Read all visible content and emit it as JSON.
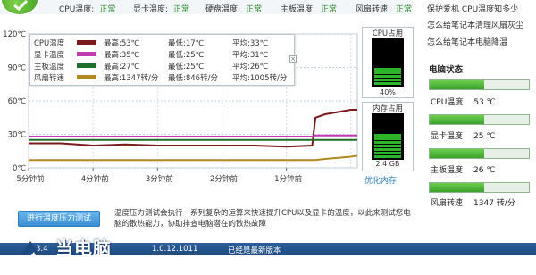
{
  "topbar": {
    "stats": [
      {
        "label": "CPU温度:",
        "status": "正常"
      },
      {
        "label": "显卡温度:",
        "status": "正常"
      },
      {
        "label": "硬盘温度:",
        "status": "正常"
      },
      {
        "label": "主板温度:",
        "status": "正常"
      },
      {
        "label": "风扇转速:",
        "status": "正常"
      }
    ]
  },
  "chart": {
    "legend": [
      {
        "name": "CPU温度",
        "max": "最高:53℃",
        "min": "最低:17℃",
        "avg": "平均:33℃",
        "color": "#7a1a1a"
      },
      {
        "name": "显卡温度",
        "max": "最高:35℃",
        "min": "最低:25℃",
        "avg": "平均:31℃",
        "color": "#c23bb0"
      },
      {
        "name": "主板温度",
        "max": "最高:27℃",
        "min": "最低:25℃",
        "avg": "平均:26℃",
        "color": "#1f6f2a"
      },
      {
        "name": "风扇转速",
        "max": "最高:1347转/分",
        "min": "最低:846转/分",
        "avg": "平均:1005转/分",
        "color": "#b08a1e"
      }
    ],
    "close_label": "×"
  },
  "chart_data": {
    "type": "line",
    "title": "",
    "xlabel": "",
    "ylabel": "",
    "y_ticks": [
      "120℃",
      "90℃",
      "60℃",
      "30℃",
      "0℃"
    ],
    "x_ticks": [
      "5分钟前",
      "4分钟前",
      "3分钟前",
      "2分钟前",
      "1分钟前"
    ],
    "ylim": [
      0,
      120
    ],
    "grid": true,
    "x": [
      0,
      0.5,
      1,
      1.5,
      2,
      2.5,
      3,
      3.5,
      4,
      4.4,
      4.45,
      4.6,
      4.8,
      5.0,
      5.1
    ],
    "series": [
      {
        "name": "CPU温度",
        "color": "#7a1a1a",
        "values": [
          22,
          22,
          20,
          21,
          20,
          20,
          20,
          20,
          19,
          20,
          45,
          48,
          50,
          52,
          52
        ]
      },
      {
        "name": "显卡温度",
        "color": "#c23bb0",
        "values": [
          28,
          28,
          28,
          28,
          28,
          28,
          28,
          28,
          28,
          28,
          29,
          29,
          29,
          29,
          29
        ]
      },
      {
        "name": "主板温度",
        "color": "#1f6f2a",
        "values": [
          25,
          25,
          25,
          25,
          25,
          25,
          25,
          25,
          25,
          25,
          25,
          25,
          25,
          25,
          25
        ]
      },
      {
        "name": "风扇转速",
        "color": "#b08a1e",
        "values": [
          7,
          7,
          7,
          7,
          7,
          7,
          7,
          7,
          7,
          7,
          7,
          8,
          9,
          10,
          11
        ]
      }
    ]
  },
  "meters": {
    "cpu": {
      "title": "CPU占用",
      "value": "40%",
      "fill": 0.4
    },
    "memory": {
      "title": "内存占用",
      "value": "2.4 GB",
      "fill": 0.6
    }
  },
  "optimize_link": "优化内存",
  "right_panel": {
    "links": [
      "保护爱机 CPU温度知多少",
      "怎么给笔记本清理风扇灰尘",
      "怎么给笔记本电脑降温"
    ],
    "section_title": "电脑状态",
    "gauges": [
      {
        "label": "CPU温度",
        "value": "53 ℃",
        "fill": 0.55
      },
      {
        "label": "显卡温度",
        "value": "25 ℃",
        "fill": 0.55
      },
      {
        "label": "主板温度",
        "value": "26 ℃",
        "fill": 0.55
      },
      {
        "label": "风扇转速",
        "value": "1347 转/分",
        "fill": 0.55
      }
    ],
    "accent": "#3aa12a"
  },
  "test": {
    "button_label": "进行温度压力测试",
    "description": "温度压力测试会执行一系列复杂的运算来快速提升CPU以及显卡的温度，以此来测试您电脑的散热能力，协助排查电脑潜在的散热故障"
  },
  "footer": {
    "left_text": "3.4",
    "version": "1.0.12.1011",
    "status": "已经是最新版本"
  },
  "watermark": {
    "text": "当电脑"
  }
}
